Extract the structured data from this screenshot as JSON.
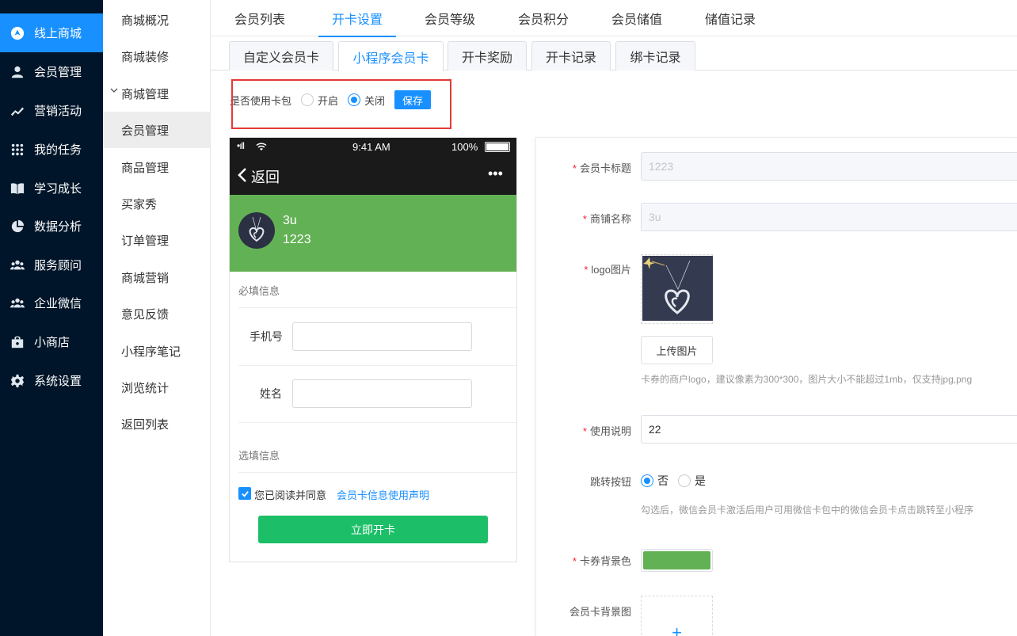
{
  "sidebar": {
    "items": [
      {
        "label": "线上商城",
        "icon": "compass-icon"
      },
      {
        "label": "会员管理",
        "icon": "user-icon"
      },
      {
        "label": "营销活动",
        "icon": "trend-icon"
      },
      {
        "label": "我的任务",
        "icon": "grid-icon"
      },
      {
        "label": "学习成长",
        "icon": "book-icon"
      },
      {
        "label": "数据分析",
        "icon": "pie-icon"
      },
      {
        "label": "服务顾问",
        "icon": "team-icon"
      },
      {
        "label": "企业微信",
        "icon": "team-icon"
      },
      {
        "label": "小商店",
        "icon": "bag-icon"
      },
      {
        "label": "系统设置",
        "icon": "gear-icon"
      }
    ],
    "active_index": 0,
    "accent": "#1890ff"
  },
  "submenu": {
    "items": [
      "商城概况",
      "商城装修",
      "商城管理",
      "会员管理",
      "商品管理",
      "买家秀",
      "订单管理",
      "商城营销",
      "意见反馈",
      "小程序笔记",
      "浏览统计",
      "返回列表"
    ],
    "active_index": 3,
    "expanded_index": 2
  },
  "top_tabs": [
    "会员列表",
    "开卡设置",
    "会员等级",
    "会员积分",
    "会员储值",
    "储值记录"
  ],
  "top_tabs_active": 1,
  "sub_tabs": [
    "自定义会员卡",
    "小程序会员卡",
    "开卡奖励",
    "开卡记录",
    "绑卡记录"
  ],
  "sub_tabs_active": 1,
  "card_pack": {
    "label": "是否使用卡包",
    "option_on": "开启",
    "option_off": "关闭",
    "selected": "关闭",
    "save": "保存"
  },
  "phone": {
    "signal": "•ıll",
    "time": "9:41 AM",
    "battery": "100%",
    "back": "返回",
    "more": "•••",
    "card_name": "3u",
    "card_title": "1223",
    "card_color": "#63b155",
    "required_title": "必填信息",
    "phone_label": "手机号",
    "name_label": "姓名",
    "optional_title": "选填信息",
    "agree_text": "您已阅读并同意",
    "agree_link": "会员卡信息使用声明",
    "open_button": "立即开卡",
    "open_color": "#1cbf67"
  },
  "form": {
    "title_label": "会员卡标题",
    "title_value": "1223",
    "shop_label": "商铺名称",
    "shop_value": "3u",
    "logo_label": "logo图片",
    "upload_label": "上传图片",
    "logo_hint": "卡券的商户logo，建议像素为300*300，图片大小不能超过1mb，仅支持jpg,png",
    "desc_label": "使用说明",
    "desc_value": "22",
    "jump_label": "跳转按钮",
    "jump_no": "否",
    "jump_yes": "是",
    "jump_selected": "否",
    "jump_hint": "勾选后，微信会员卡激活后用户可用微信卡包中的微信会员卡点击跳转至小程序",
    "bgcolor_label": "卡券背景色",
    "bgcolor_value": "#63b155",
    "bgimg_label": "会员卡背景图",
    "plus": "+"
  }
}
